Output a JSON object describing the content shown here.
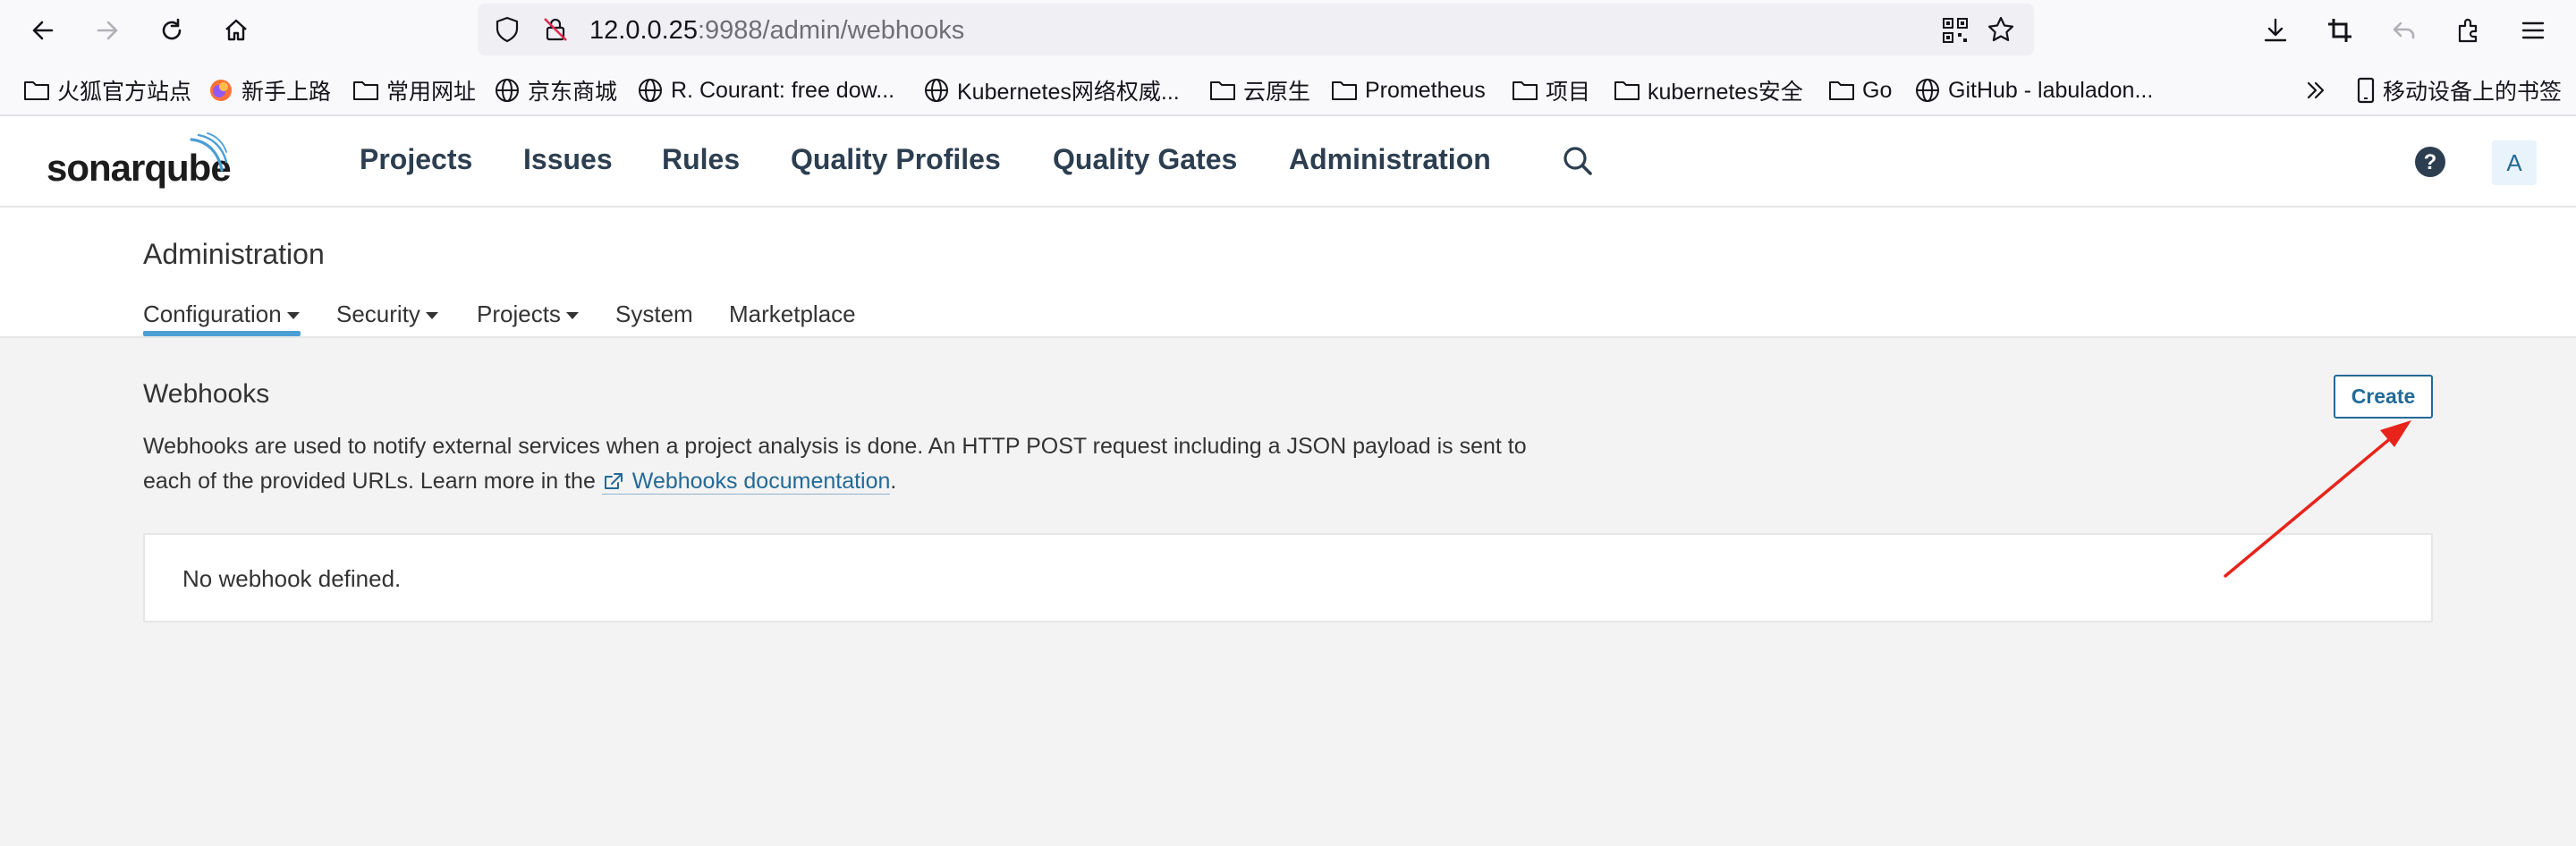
{
  "browser": {
    "url_host": "12.0.0.25",
    "url_rest": ":9988/admin/webhooks",
    "bookmarks": [
      {
        "label": "火狐官方站点",
        "icon": "folder-icon"
      },
      {
        "label": "新手上路",
        "icon": "firefox-icon"
      },
      {
        "label": "常用网址",
        "icon": "folder-icon"
      },
      {
        "label": "京东商城",
        "icon": "globe-icon"
      },
      {
        "label": "R. Courant: free dow...",
        "icon": "globe-icon"
      },
      {
        "label": "Kubernetes网络权威...",
        "icon": "globe-icon"
      },
      {
        "label": "云原生",
        "icon": "folder-icon"
      },
      {
        "label": "Prometheus",
        "icon": "folder-icon"
      },
      {
        "label": "项目",
        "icon": "folder-icon"
      },
      {
        "label": "kubernetes安全",
        "icon": "folder-icon"
      },
      {
        "label": "Go",
        "icon": "folder-icon"
      },
      {
        "label": "GitHub - labuladon...",
        "icon": "globe-icon"
      }
    ],
    "mobile_bookmarks": "移动设备上的书签"
  },
  "app": {
    "logo_text": "sonarqube",
    "nav": [
      "Projects",
      "Issues",
      "Rules",
      "Quality Profiles",
      "Quality Gates",
      "Administration"
    ],
    "avatar_letter": "A"
  },
  "page": {
    "title": "Administration",
    "tabs": [
      "Configuration",
      "Security",
      "Projects",
      "System",
      "Marketplace"
    ],
    "active_tab": "Configuration"
  },
  "webhooks": {
    "title": "Webhooks",
    "desc_part1": "Webhooks are used to notify external services when a project analysis is done. An HTTP POST request including a JSON payload is sent to each of the provided URLs. Learn more in the ",
    "link_text": "Webhooks documentation",
    "desc_end": ".",
    "create_label": "Create",
    "empty_text": "No webhook defined."
  },
  "colors": {
    "accent": "#236a97",
    "tab_underline": "#4b9fd5",
    "annotation_arrow": "#e8231b"
  }
}
